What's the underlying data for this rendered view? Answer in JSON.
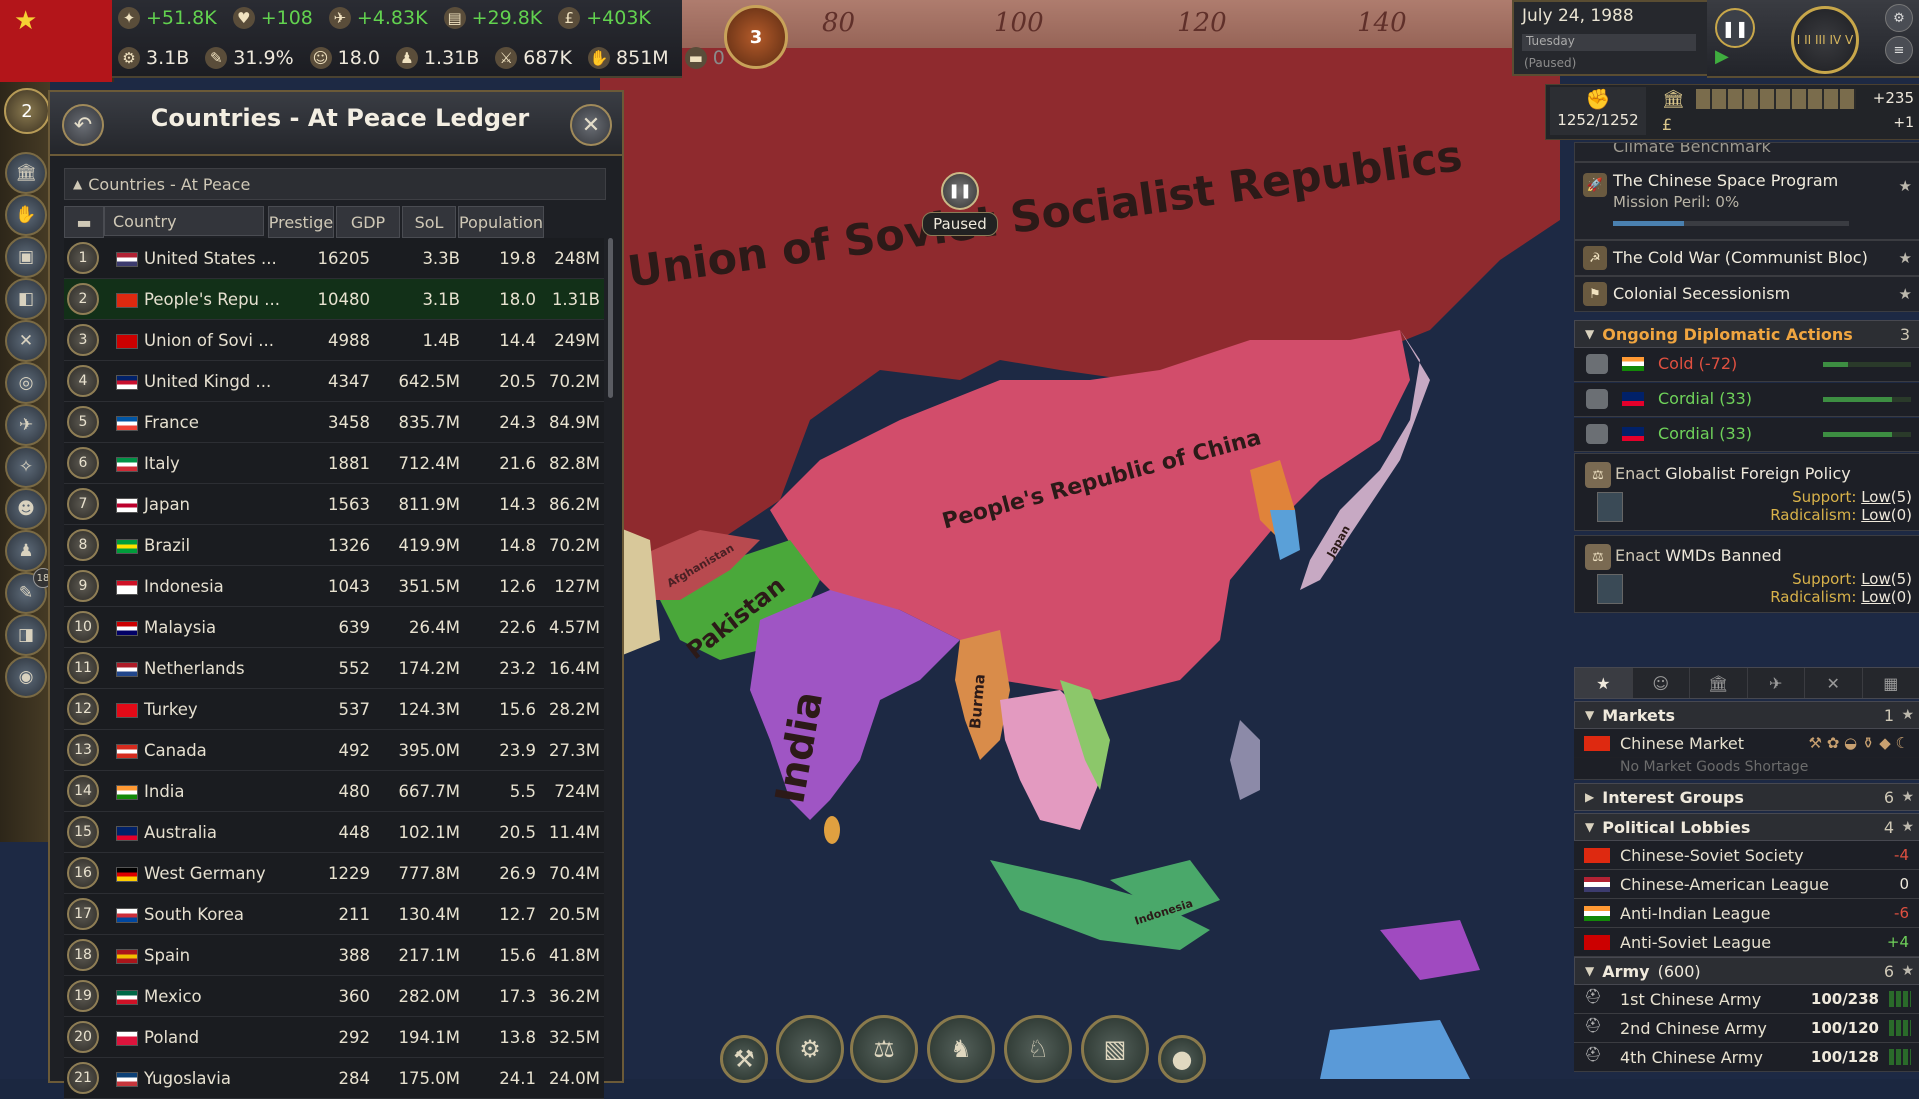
{
  "resources": {
    "row1": [
      {
        "icon": "legitimacy-icon",
        "glyph": "✦",
        "value": "+51.8K",
        "green": true
      },
      {
        "icon": "heart-icon",
        "glyph": "♥",
        "value": "+108",
        "green": true
      },
      {
        "icon": "influence-icon",
        "glyph": "✈",
        "value": "+4.83K",
        "green": true
      },
      {
        "icon": "bureaucracy-icon",
        "glyph": "▤",
        "value": "+29.8K",
        "green": true
      },
      {
        "icon": "money-icon",
        "glyph": "£",
        "value": "+403K",
        "green": true
      }
    ],
    "row2": [
      {
        "icon": "gdp-icon",
        "glyph": "⚙",
        "value": "3.1B"
      },
      {
        "icon": "literacy-icon",
        "glyph": "✎",
        "value": "31.9%"
      },
      {
        "icon": "sol-icon",
        "glyph": "☺",
        "value": "18.0"
      },
      {
        "icon": "population-icon",
        "glyph": "♟",
        "value": "1.31B"
      },
      {
        "icon": "army-icon",
        "glyph": "⚔",
        "value": "687K"
      },
      {
        "icon": "workforce-icon",
        "glyph": "✋",
        "value": "851M"
      },
      {
        "icon": "infamy-icon",
        "glyph": "▬",
        "value": "0",
        "muted": true
      }
    ]
  },
  "medal_count": "2",
  "side_buttons": [
    {
      "name": "government-button",
      "glyph": "🏛"
    },
    {
      "name": "budget-button",
      "glyph": "✋"
    },
    {
      "name": "buildings-button",
      "glyph": "▣"
    },
    {
      "name": "production-button",
      "glyph": "◧"
    },
    {
      "name": "military-button",
      "glyph": "✕"
    },
    {
      "name": "diplomacy-button",
      "glyph": "◎"
    },
    {
      "name": "trade-button",
      "glyph": "✈"
    },
    {
      "name": "technology-button",
      "glyph": "✧"
    },
    {
      "name": "politics-button",
      "glyph": "☻"
    },
    {
      "name": "population-button",
      "glyph": "♟"
    },
    {
      "name": "journal-button",
      "glyph": "✎",
      "badge": "18"
    },
    {
      "name": "ledger-button",
      "glyph": "◨"
    },
    {
      "name": "map-button",
      "glyph": "◉"
    }
  ],
  "ledger": {
    "title": "Countries - At Peace Ledger",
    "section": "Countries - At Peace",
    "columns": {
      "country": "Country",
      "prestige": "Prestige",
      "gdp": "GDP",
      "sol": "SoL",
      "population": "Population"
    },
    "rows": [
      {
        "rank": "1",
        "country": "United States ...",
        "prestige": "16205",
        "gdp": "3.3B",
        "sol": "19.8",
        "population": "248M",
        "flag": [
          "#b22234",
          "#ffffff",
          "#3c3b6e"
        ]
      },
      {
        "rank": "2",
        "country": "People's Repu ...",
        "prestige": "10480",
        "gdp": "3.1B",
        "sol": "18.0",
        "population": "1.31B",
        "flag": [
          "#de2910",
          "#de2910",
          "#de2910"
        ],
        "selected": true
      },
      {
        "rank": "3",
        "country": "Union of Sovi ...",
        "prestige": "4988",
        "gdp": "1.4B",
        "sol": "14.4",
        "population": "249M",
        "flag": [
          "#cc0000",
          "#cc0000",
          "#cc0000"
        ]
      },
      {
        "rank": "4",
        "country": "United Kingd ...",
        "prestige": "4347",
        "gdp": "642.5M",
        "sol": "20.5",
        "population": "70.2M",
        "flag": [
          "#012169",
          "#c8102e",
          "#ffffff"
        ]
      },
      {
        "rank": "5",
        "country": "France",
        "prestige": "3458",
        "gdp": "835.7M",
        "sol": "24.3",
        "population": "84.9M",
        "flag": [
          "#0055a4",
          "#ffffff",
          "#ef4135"
        ]
      },
      {
        "rank": "6",
        "country": "Italy",
        "prestige": "1881",
        "gdp": "712.4M",
        "sol": "21.6",
        "population": "82.8M",
        "flag": [
          "#009246",
          "#ffffff",
          "#ce2b37"
        ]
      },
      {
        "rank": "7",
        "country": "Japan",
        "prestige": "1563",
        "gdp": "811.9M",
        "sol": "14.3",
        "population": "86.2M",
        "flag": [
          "#ffffff",
          "#bc002d",
          "#ffffff"
        ]
      },
      {
        "rank": "8",
        "country": "Brazil",
        "prestige": "1326",
        "gdp": "419.9M",
        "sol": "14.8",
        "population": "70.2M",
        "flag": [
          "#009c3b",
          "#ffdf00",
          "#009c3b"
        ]
      },
      {
        "rank": "9",
        "country": "Indonesia",
        "prestige": "1043",
        "gdp": "351.5M",
        "sol": "12.6",
        "population": "127M",
        "flag": [
          "#ce1126",
          "#ffffff",
          "#ffffff"
        ]
      },
      {
        "rank": "10",
        "country": "Malaysia",
        "prestige": "639",
        "gdp": "26.4M",
        "sol": "22.6",
        "population": "4.57M",
        "flag": [
          "#cc0001",
          "#ffffff",
          "#010066"
        ]
      },
      {
        "rank": "11",
        "country": "Netherlands",
        "prestige": "552",
        "gdp": "174.2M",
        "sol": "23.2",
        "population": "16.4M",
        "flag": [
          "#ae1c28",
          "#ffffff",
          "#21468b"
        ]
      },
      {
        "rank": "12",
        "country": "Turkey",
        "prestige": "537",
        "gdp": "124.3M",
        "sol": "15.6",
        "population": "28.2M",
        "flag": [
          "#e30a17",
          "#e30a17",
          "#e30a17"
        ]
      },
      {
        "rank": "13",
        "country": "Canada",
        "prestige": "492",
        "gdp": "395.0M",
        "sol": "23.9",
        "population": "27.3M",
        "flag": [
          "#d52b1e",
          "#ffffff",
          "#d52b1e"
        ]
      },
      {
        "rank": "14",
        "country": "India",
        "prestige": "480",
        "gdp": "667.7M",
        "sol": "5.5",
        "population": "724M",
        "flag": [
          "#ff9933",
          "#ffffff",
          "#138808"
        ]
      },
      {
        "rank": "15",
        "country": "Australia",
        "prestige": "448",
        "gdp": "102.1M",
        "sol": "20.5",
        "population": "11.4M",
        "flag": [
          "#012169",
          "#012169",
          "#e4002b"
        ]
      },
      {
        "rank": "16",
        "country": "West Germany",
        "prestige": "1229",
        "gdp": "777.8M",
        "sol": "26.9",
        "population": "70.4M",
        "flag": [
          "#000000",
          "#dd0000",
          "#ffce00"
        ]
      },
      {
        "rank": "17",
        "country": "South Korea",
        "prestige": "211",
        "gdp": "130.4M",
        "sol": "12.7",
        "population": "20.5M",
        "flag": [
          "#ffffff",
          "#cd2e3a",
          "#0047a0"
        ]
      },
      {
        "rank": "18",
        "country": "Spain",
        "prestige": "388",
        "gdp": "217.1M",
        "sol": "15.6",
        "population": "41.8M",
        "flag": [
          "#aa151b",
          "#f1bf00",
          "#aa151b"
        ]
      },
      {
        "rank": "19",
        "country": "Mexico",
        "prestige": "360",
        "gdp": "282.0M",
        "sol": "17.3",
        "population": "36.2M",
        "flag": [
          "#006847",
          "#ffffff",
          "#ce1126"
        ]
      },
      {
        "rank": "20",
        "country": "Poland",
        "prestige": "292",
        "gdp": "194.1M",
        "sol": "13.8",
        "population": "32.5M",
        "flag": [
          "#ffffff",
          "#dc143c",
          "#dc143c"
        ]
      },
      {
        "rank": "21",
        "country": "Yugoslavia",
        "prestige": "284",
        "gdp": "175.0M",
        "sol": "24.1",
        "population": "24.0M",
        "flag": [
          "#0c4076",
          "#ffffff",
          "#c6363c"
        ]
      }
    ]
  },
  "map": {
    "ruler_ticks": [
      "80",
      "100",
      "120",
      "140"
    ],
    "alert_count": "3",
    "paused_label": "Paused",
    "labels": {
      "ussr": "Union of Soviet Socialist Republics",
      "china": "People's Republic of China",
      "india": "India",
      "pakistan": "Pakistan",
      "burma": "Burma",
      "afghanistan": "Afghanistan",
      "indonesia": "Indonesia",
      "japan": "Japan"
    }
  },
  "date": {
    "date": "July 24, 1988",
    "weekday": "Tuesday",
    "status": "(Paused)"
  },
  "speed": {
    "levels": "I II III IV V"
  },
  "authority": {
    "value": "1252/1252",
    "bank": "+235",
    "pound": "+1"
  },
  "outliner": {
    "journal": [
      {
        "title": "Climate Benchmark",
        "sub": ""
      },
      {
        "title": "The Chinese Space Program",
        "sub": "Mission Peril: 0%"
      },
      {
        "title": "The Cold War (Communist Bloc)"
      },
      {
        "title": "Colonial Secessionism"
      }
    ],
    "diplomatic": {
      "header": "Ongoing Diplomatic Actions",
      "count": "3",
      "items": [
        {
          "label": "Cold (-72)",
          "color": "#e05040",
          "flag": [
            "#ff9933",
            "#ffffff",
            "#138808"
          ],
          "bar": 0.28
        },
        {
          "label": "Cordial (33)",
          "color": "#6fd25a",
          "flag": [
            "#012169",
            "#012169",
            "#e4002b"
          ],
          "bar": 0.78
        },
        {
          "label": "Cordial (33)",
          "color": "#6fd25a",
          "flag": [
            "#012169",
            "#012169",
            "#e4002b"
          ],
          "bar": 0.78
        }
      ]
    },
    "laws": [
      {
        "prefix": "Enact",
        "name": "Globalist Foreign Policy",
        "support": "Low",
        "support_n": "(5)",
        "radical": "Low",
        "radical_n": "(0)"
      },
      {
        "prefix": "Enact",
        "name": "WMDs Banned",
        "support": "Low",
        "support_n": "(5)",
        "radical": "Low",
        "radical_n": "(0)"
      }
    ],
    "labels": {
      "support": "Support:",
      "radicalism": "Radicalism:"
    },
    "tabs": [
      "★",
      "☺",
      "🏛",
      "✈",
      "✕",
      "▦"
    ],
    "markets": {
      "header": "Markets",
      "count": "1",
      "name": "Chinese Market",
      "note": "No Market Goods Shortage"
    },
    "interest_groups": {
      "header": "Interest Groups",
      "count": "6"
    },
    "lobbies": {
      "header": "Political Lobbies",
      "count": "4",
      "items": [
        {
          "name": "Chinese-Soviet Society",
          "value": "-4",
          "kind": "neg",
          "flag": [
            "#de2910",
            "#de2910",
            "#de2910"
          ]
        },
        {
          "name": "Chinese-American League",
          "value": "0",
          "kind": "",
          "flag": [
            "#b22234",
            "#ffffff",
            "#3c3b6e"
          ]
        },
        {
          "name": "Anti-Indian League",
          "value": "-6",
          "kind": "neg",
          "flag": [
            "#ff9933",
            "#ffffff",
            "#138808"
          ]
        },
        {
          "name": "Anti-Soviet League",
          "value": "+4",
          "kind": "pos",
          "flag": [
            "#cc0000",
            "#cc0000",
            "#cc0000"
          ]
        }
      ]
    },
    "army": {
      "header": "Army",
      "strength": "(600)",
      "count": "6",
      "items": [
        {
          "name": "1st Chinese Army",
          "value": "100/238"
        },
        {
          "name": "2nd Chinese Army",
          "value": "100/120"
        },
        {
          "name": "4th Chinese Army",
          "value": "100/128"
        }
      ]
    }
  },
  "bottom_buttons": [
    {
      "name": "build-button",
      "glyph": "⚒"
    },
    {
      "name": "production-methods-button",
      "glyph": "⚙"
    },
    {
      "name": "laws-button",
      "glyph": "⚖"
    },
    {
      "name": "diplomacy-button",
      "glyph": "♞"
    },
    {
      "name": "military-button",
      "glyph": "♘"
    },
    {
      "name": "map-modes-button",
      "glyph": "▧"
    },
    {
      "name": "extra-button",
      "glyph": "●"
    }
  ]
}
